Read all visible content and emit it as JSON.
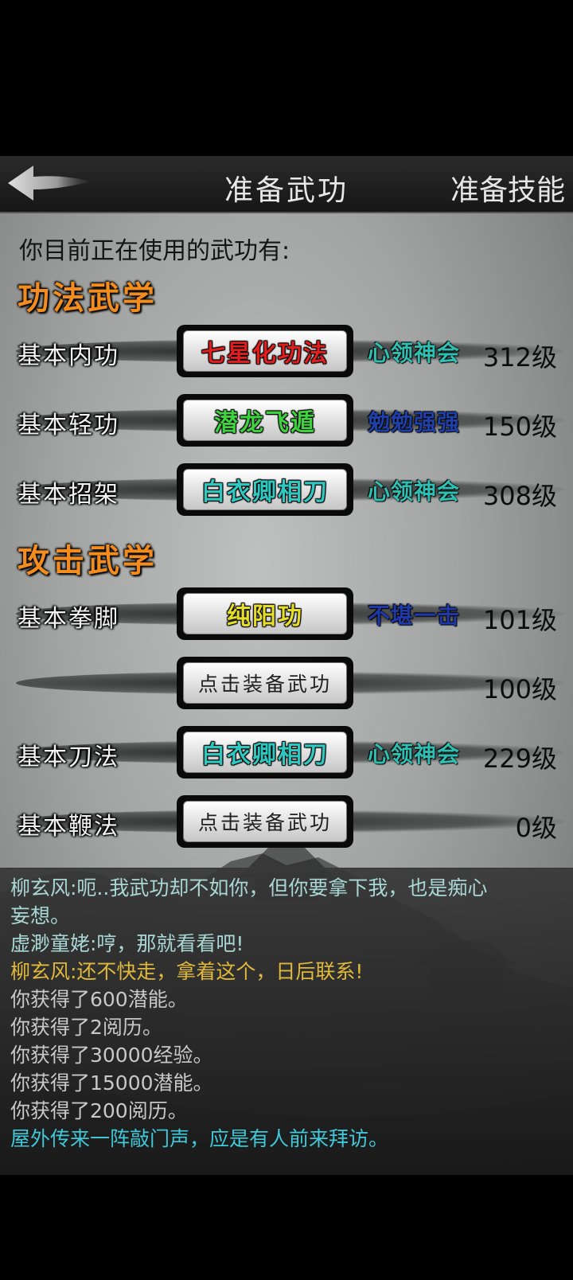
{
  "header": {
    "title": "准备武功",
    "right_tab": "准备技能"
  },
  "subtitle": "你目前正在使用的武功有:",
  "sections": [
    {
      "title": "功法武学",
      "rows": [
        {
          "label": "基本内功",
          "skill": "七星化功法",
          "skill_color": "#e01e1e",
          "mastery": "心领神会",
          "mastery_color": "#2fbfb2",
          "level": "312级"
        },
        {
          "label": "基本轻功",
          "skill": "潜龙飞遁",
          "skill_color": "#3fd23f",
          "mastery": "勉勉强强",
          "mastery_color": "#1f3fa8",
          "level": "150级"
        },
        {
          "label": "基本招架",
          "skill": "白衣卿相刀",
          "skill_color": "#2fc8c0",
          "mastery": "心领神会",
          "mastery_color": "#2fbfb2",
          "level": "308级"
        }
      ]
    },
    {
      "title": "攻击武学",
      "rows": [
        {
          "label": "基本拳脚",
          "skill": "纯阳功",
          "skill_color": "#e6dd2a",
          "mastery": "不堪一击",
          "mastery_color": "#1e38a6",
          "level": "101级"
        },
        {
          "label": "",
          "skill": "点击装备武功",
          "empty": true,
          "mastery": "",
          "level": "100级"
        },
        {
          "label": "基本刀法",
          "skill": "白衣卿相刀",
          "skill_color": "#2fc8c0",
          "mastery": "心领神会",
          "mastery_color": "#2fbfb2",
          "level": "229级"
        },
        {
          "label": "基本鞭法",
          "skill": "点击装备武功",
          "empty": true,
          "mastery": "",
          "level": "0级"
        }
      ]
    }
  ],
  "log": [
    {
      "text": "柳玄风:呃..我武功却不如你，但你要拿下我，也是痴心",
      "color": "#a9d8d4"
    },
    {
      "text": "妄想。",
      "color": "#a9d8d4"
    },
    {
      "text": "虚渺童姥:哼，那就看看吧!",
      "color": "#a9d8d4"
    },
    {
      "text": "柳玄风:还不快走，拿着这个，日后联系!",
      "color": "#e0b93a"
    },
    {
      "text": "你获得了600潜能。",
      "color": "#c8c8c8"
    },
    {
      "text": "你获得了2阅历。",
      "color": "#c8c8c8"
    },
    {
      "text": "你获得了30000经验。",
      "color": "#c8c8c8"
    },
    {
      "text": "你获得了15000潜能。",
      "color": "#c8c8c8"
    },
    {
      "text": "你获得了200阅历。",
      "color": "#c8c8c8"
    },
    {
      "text": "屋外传来一阵敲门声，应是有人前来拜访。",
      "color": "#40c8d8"
    }
  ],
  "icons": {
    "back": "back-arrow-icon"
  }
}
